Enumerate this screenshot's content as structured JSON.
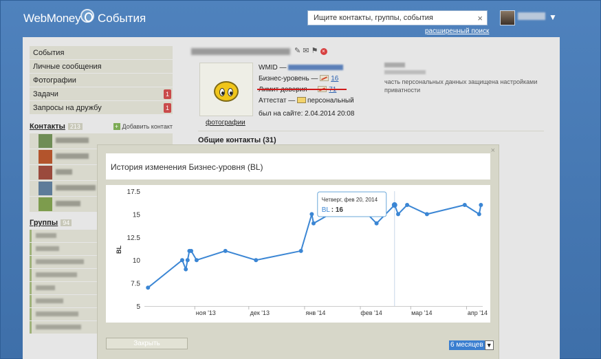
{
  "header": {
    "logo_text": "WebMoney",
    "section_title": "События",
    "search_placeholder": "Ищите контакты, группы, события",
    "advanced_search": "расширенный поиск"
  },
  "sidebar": {
    "menu": [
      {
        "label": "События",
        "badge": ""
      },
      {
        "label": "Личные сообщения",
        "badge": ""
      },
      {
        "label": "Фотографии",
        "badge": ""
      },
      {
        "label": "Задачи",
        "badge": "1"
      },
      {
        "label": "Запросы на дружбу",
        "badge": "1"
      }
    ],
    "contacts_title": "Контакты",
    "contacts_count": "213",
    "add_contact": "Добавить контакт",
    "groups_title": "Группы",
    "groups_count": "94"
  },
  "profile": {
    "wmid_label": "WMID —",
    "bl_label": "Бизнес-уровень —",
    "bl_value": "16",
    "trust_label": "Лимит доверия —",
    "trust_value": "71",
    "attestat_label": "Аттестат —",
    "attestat_value": "персональный",
    "last_seen": "был на сайте: 2.04.2014 20:08",
    "photos_link": "фотографии",
    "privacy_note": "часть персональных данных защищена настройками приватности",
    "common_contacts": "Общие контакты (31)"
  },
  "modal": {
    "title": "История изменения Бизнес-уровня (BL)",
    "close_button": "Закрыть",
    "period": "6 месяцев",
    "close_x": "×"
  },
  "chart_data": {
    "type": "line",
    "title": "",
    "ylabel": "BL",
    "xlabel": "",
    "ylim": [
      5,
      17.5
    ],
    "yticks": [
      "17.5",
      "15",
      "12.5",
      "10",
      "7.5",
      "5"
    ],
    "xtick_labels": [
      "ноя '13",
      "дек '13",
      "янв '14",
      "фев '14",
      "мар '14",
      "апр '14"
    ],
    "series": [
      {
        "name": "BL",
        "color": "#3b86d4",
        "points": [
          {
            "x": "2013-10-06",
            "y": 7
          },
          {
            "x": "2013-10-25",
            "y": 10
          },
          {
            "x": "2013-10-27",
            "y": 9
          },
          {
            "x": "2013-10-28",
            "y": 10
          },
          {
            "x": "2013-10-29",
            "y": 11
          },
          {
            "x": "2013-10-30",
            "y": 11
          },
          {
            "x": "2013-11-02",
            "y": 10
          },
          {
            "x": "2013-11-18",
            "y": 11
          },
          {
            "x": "2013-12-05",
            "y": 10
          },
          {
            "x": "2013-12-30",
            "y": 11
          },
          {
            "x": "2014-01-05",
            "y": 15
          },
          {
            "x": "2014-01-06",
            "y": 14
          },
          {
            "x": "2014-01-15",
            "y": 15
          },
          {
            "x": "2014-02-05",
            "y": 15
          },
          {
            "x": "2014-02-10",
            "y": 14
          },
          {
            "x": "2014-02-20",
            "y": 16
          },
          {
            "x": "2014-02-22",
            "y": 15
          },
          {
            "x": "2014-02-27",
            "y": 16
          },
          {
            "x": "2014-03-10",
            "y": 15
          },
          {
            "x": "2014-03-31",
            "y": 16
          },
          {
            "x": "2014-04-08",
            "y": 15
          },
          {
            "x": "2014-04-09",
            "y": 16
          }
        ]
      }
    ],
    "tooltip": {
      "date": "Четверг, фев 20, 2014",
      "label": "BL",
      "value": "16"
    },
    "grid": false
  }
}
